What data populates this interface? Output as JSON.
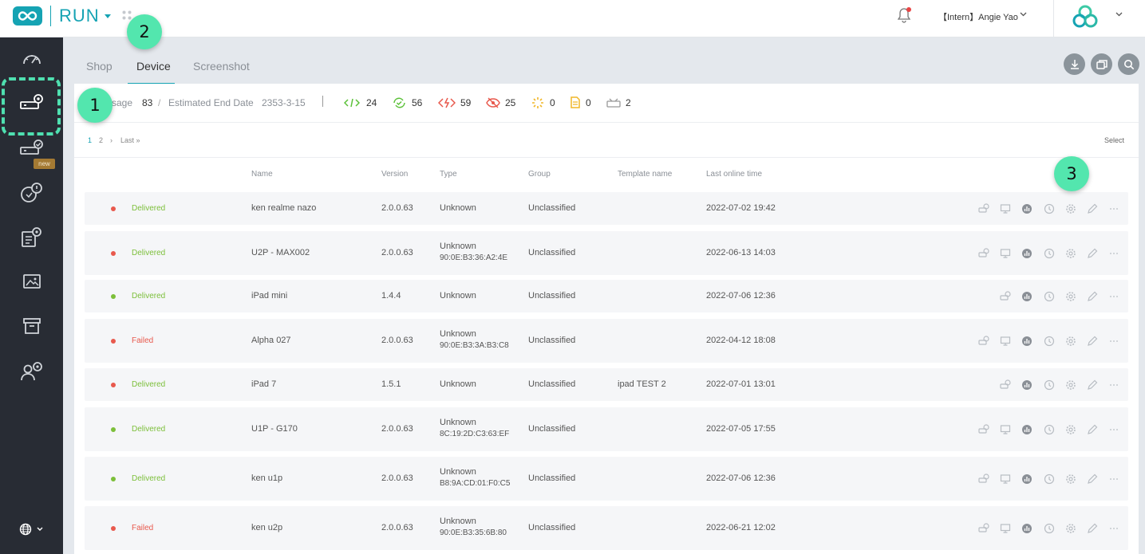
{
  "header": {
    "app_name": "RUN",
    "user": "【Intern】Angie Yao"
  },
  "tabs": [
    {
      "label": "Shop"
    },
    {
      "label": "Device"
    },
    {
      "label": "Screenshot"
    }
  ],
  "sidebar": {
    "new_badge": "new"
  },
  "stats": {
    "usage_label": "sage",
    "usage_value": "83",
    "sep": "/",
    "end_date_label": "Estimated End Date",
    "end_date_value": "2353-3-15",
    "counts": [
      "24",
      "56",
      "59",
      "25",
      "0",
      "0",
      "2"
    ]
  },
  "pagination": {
    "pages": [
      "1",
      "2"
    ],
    "next": "›",
    "last": "Last »",
    "select": "Select"
  },
  "table": {
    "headers": [
      "Name",
      "Version",
      "Type",
      "Group",
      "Template name",
      "Last online time"
    ],
    "rows": [
      {
        "status_color": "red",
        "status": "Delivered",
        "name": "ken realme nazo",
        "version": "2.0.0.63",
        "type": "Unknown",
        "type_sub": "",
        "group": "Unclassified",
        "template": "",
        "last_online": "2022-07-02 19:42"
      },
      {
        "status_color": "red",
        "status": "Delivered",
        "name": "U2P - MAX002",
        "version": "2.0.0.63",
        "type": "Unknown",
        "type_sub": "90:0E:B3:36:A2:4E",
        "group": "Unclassified",
        "template": "",
        "last_online": "2022-06-13 14:03"
      },
      {
        "status_color": "green",
        "status": "Delivered",
        "name": "iPad mini",
        "version": "1.4.4",
        "type": "Unknown",
        "type_sub": "",
        "group": "Unclassified",
        "template": "",
        "last_online": "2022-07-06 12:36"
      },
      {
        "status_color": "red",
        "status": "Failed",
        "name": "Alpha 027",
        "version": "2.0.0.63",
        "type": "Unknown",
        "type_sub": "90:0E:B3:3A:B3:C8",
        "group": "Unclassified",
        "template": "",
        "last_online": "2022-04-12 18:08"
      },
      {
        "status_color": "red",
        "status": "Delivered",
        "name": "iPad 7",
        "version": "1.5.1",
        "type": "Unknown",
        "type_sub": "",
        "group": "Unclassified",
        "template": "ipad TEST 2",
        "last_online": "2022-07-01 13:01"
      },
      {
        "status_color": "green",
        "status": "Delivered",
        "name": "U1P - G170",
        "version": "2.0.0.63",
        "type": "Unknown",
        "type_sub": "8C:19:2D:C3:63:EF",
        "group": "Unclassified",
        "template": "",
        "last_online": "2022-07-05 17:55"
      },
      {
        "status_color": "green",
        "status": "Delivered",
        "name": "ken u1p",
        "version": "2.0.0.63",
        "type": "Unknown",
        "type_sub": "B8:9A:CD:01:F0:C5",
        "group": "Unclassified",
        "template": "",
        "last_online": "2022-07-06 12:36"
      },
      {
        "status_color": "red",
        "status": "Failed",
        "name": "ken u2p",
        "version": "2.0.0.63",
        "type": "Unknown",
        "type_sub": "90:0E:B3:35:6B:80",
        "group": "Unclassified",
        "template": "",
        "last_online": "2022-06-21 12:02"
      }
    ]
  },
  "annotations": [
    "1",
    "2",
    "3"
  ],
  "colors": {
    "brand": "#15a3b3",
    "delivered": "#7cbf3a",
    "failed": "#e8594d",
    "dot_red": "#e8594d",
    "dot_green": "#7cbf3a",
    "bubble": "#53e6ae"
  }
}
